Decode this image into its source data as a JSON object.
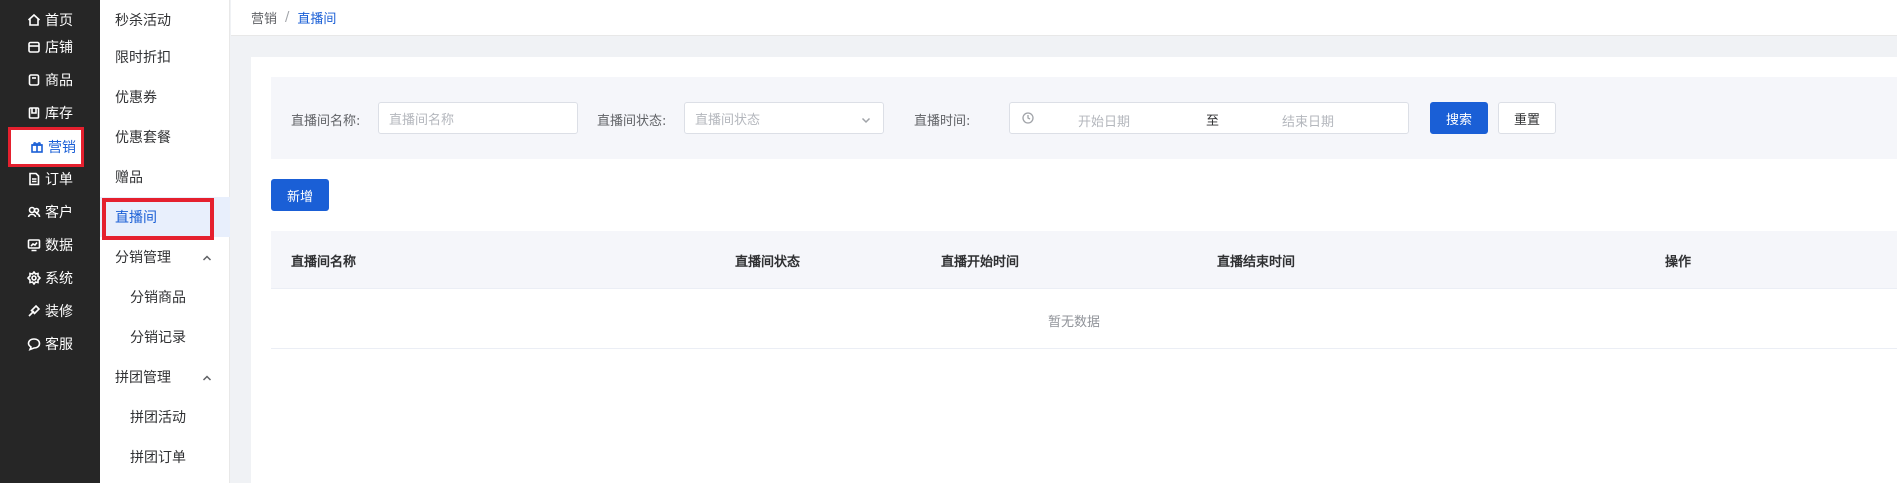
{
  "nav": {
    "items": [
      {
        "label": "首页",
        "icon": "home-icon"
      },
      {
        "label": "店铺",
        "icon": "shop-icon"
      },
      {
        "label": "商品",
        "icon": "goods-icon"
      },
      {
        "label": "库存",
        "icon": "inventory-icon"
      },
      {
        "label": "营销",
        "icon": "gift-icon"
      },
      {
        "label": "订单",
        "icon": "order-icon"
      },
      {
        "label": "客户",
        "icon": "customer-icon"
      },
      {
        "label": "数据",
        "icon": "data-icon"
      },
      {
        "label": "系统",
        "icon": "gear-icon"
      },
      {
        "label": "装修",
        "icon": "decor-icon"
      },
      {
        "label": "客服",
        "icon": "chat-icon"
      }
    ],
    "active": "营销"
  },
  "submenu": {
    "items": [
      {
        "label": "秒杀活动"
      },
      {
        "label": "限时折扣"
      },
      {
        "label": "优惠券"
      },
      {
        "label": "优惠套餐"
      },
      {
        "label": "赠品"
      },
      {
        "label": "直播间"
      },
      {
        "label": "分销管理"
      },
      {
        "label": "分销商品"
      },
      {
        "label": "分销记录"
      },
      {
        "label": "拼团管理"
      },
      {
        "label": "拼团活动"
      },
      {
        "label": "拼团订单"
      }
    ],
    "active": "直播间"
  },
  "breadcrumb": {
    "parent": "营销",
    "separator": "/",
    "current": "直播间"
  },
  "filter": {
    "name_label": "直播间名称:",
    "name_placeholder": "直播间名称",
    "status_label": "直播间状态:",
    "status_placeholder": "直播间状态",
    "time_label": "直播时间:",
    "start_placeholder": "开始日期",
    "range_separator": "至",
    "end_placeholder": "结束日期",
    "search_label": "搜索",
    "reset_label": "重置"
  },
  "toolbar": {
    "add_label": "新增"
  },
  "table": {
    "columns": [
      "直播间名称",
      "直播间状态",
      "直播开始时间",
      "直播结束时间",
      "操作"
    ],
    "rows": [],
    "empty_text": "暂无数据"
  },
  "colors": {
    "primary": "#1a5fd6",
    "nav_bg": "#262626",
    "highlight_box": "#e5202e"
  }
}
